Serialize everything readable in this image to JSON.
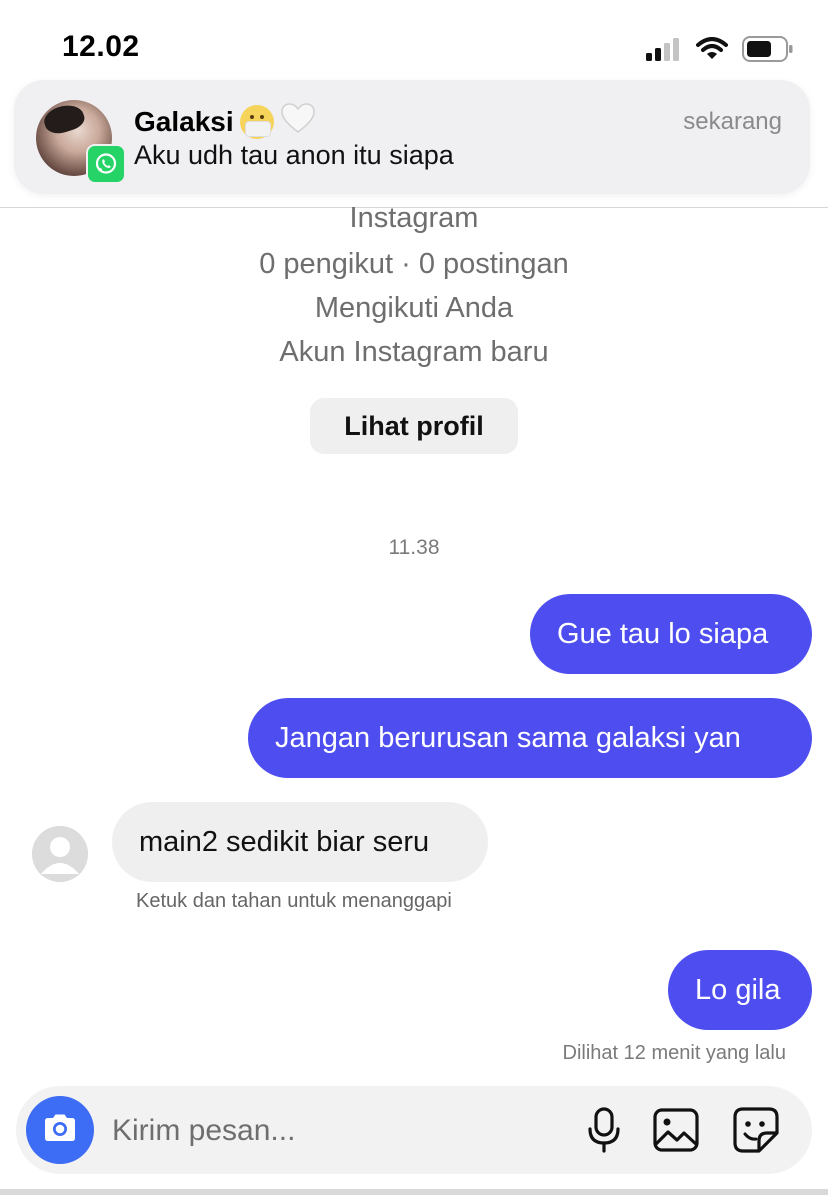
{
  "status_bar": {
    "time": "12.02"
  },
  "notification": {
    "sender": "Galaksi",
    "message": "Aku udh tau anon itu siapa",
    "time": "sekarang",
    "app_icon": "whatsapp-icon"
  },
  "profile": {
    "platform": "Instagram",
    "stats": "0 pengikut · 0 postingan",
    "follow_status": "Mengikuti Anda",
    "account_note": "Akun Instagram baru",
    "view_profile_label": "Lihat profil"
  },
  "conversation": {
    "timestamp": "11.38",
    "messages": [
      {
        "direction": "outgoing",
        "text": "Gue tau lo siapa"
      },
      {
        "direction": "outgoing",
        "text": "Jangan berurusan sama galaksi yan"
      },
      {
        "direction": "incoming",
        "text": "main2 sedikit biar seru"
      },
      {
        "direction": "outgoing",
        "text": "Lo gila"
      }
    ],
    "reply_hint": "Ketuk dan tahan untuk menanggapi",
    "seen_status": "Dilihat 12 menit yang lalu"
  },
  "composer": {
    "placeholder": "Kirim pesan...",
    "icons": [
      "camera-icon",
      "microphone-icon",
      "gallery-icon",
      "sticker-icon"
    ]
  },
  "colors": {
    "outgoing_bubble": "#4e4ef0",
    "incoming_bubble": "#efefef",
    "camera_button": "#3d6cf5",
    "whatsapp_green": "#25d366"
  }
}
